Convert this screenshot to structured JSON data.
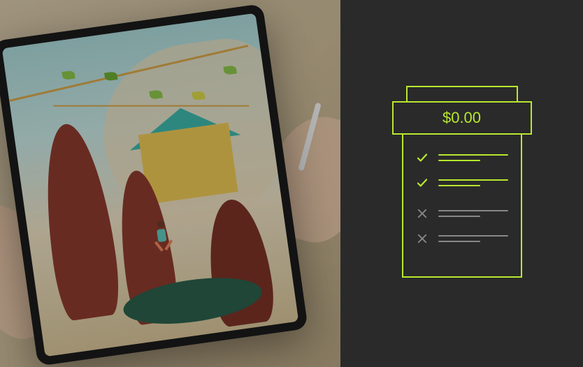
{
  "receipt": {
    "price": "$0.00",
    "rows": [
      {
        "icon": "check",
        "color": "green"
      },
      {
        "icon": "check",
        "color": "green"
      },
      {
        "icon": "x",
        "color": "gray"
      },
      {
        "icon": "x",
        "color": "gray"
      }
    ]
  }
}
